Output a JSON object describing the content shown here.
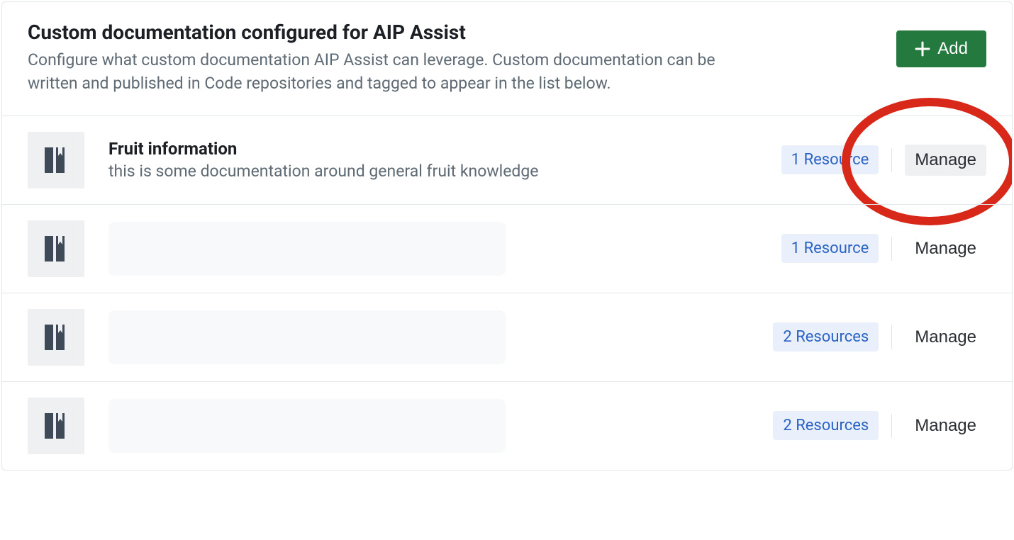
{
  "header": {
    "title": "Custom documentation configured for AIP Assist",
    "subtitle": "Configure what custom documentation AIP Assist can leverage. Custom documentation can be written and published in Code repositories and tagged to appear in the list below.",
    "add_label": "Add"
  },
  "rows": [
    {
      "title": "Fruit information",
      "desc": "this is some documentation around general fruit knowledge",
      "resource_label": "1 Resource",
      "manage_label": "Manage",
      "redacted": false,
      "manage_hover": true,
      "highlight": true
    },
    {
      "title": "",
      "desc": "",
      "resource_label": "1 Resource",
      "manage_label": "Manage",
      "redacted": true,
      "manage_hover": false,
      "highlight": false
    },
    {
      "title": "",
      "desc": "",
      "resource_label": "2 Resources",
      "manage_label": "Manage",
      "redacted": true,
      "manage_hover": false,
      "highlight": false
    },
    {
      "title": "",
      "desc": "",
      "resource_label": "2 Resources",
      "manage_label": "Manage",
      "redacted": true,
      "manage_hover": false,
      "highlight": false
    }
  ]
}
